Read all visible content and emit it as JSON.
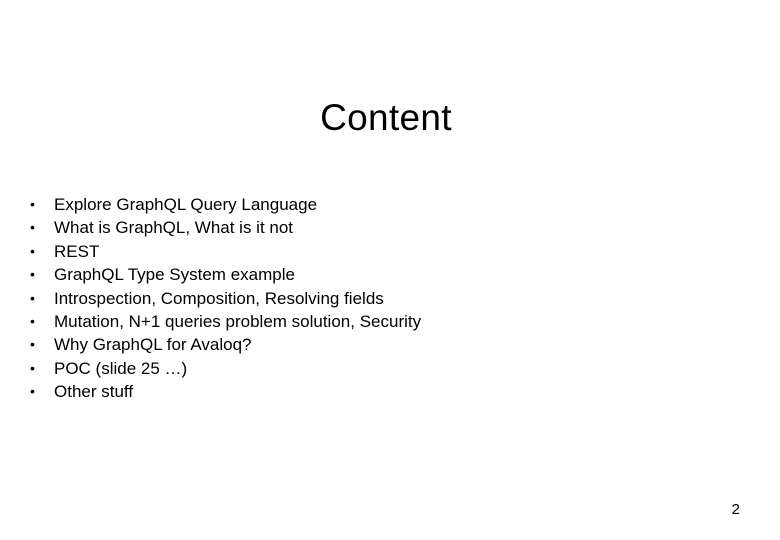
{
  "slide": {
    "title": "Content",
    "bullet_symbol": "•",
    "items": [
      {
        "text": "Explore GraphQL Query Language"
      },
      {
        "text": "What is GraphQL, What is it not"
      },
      {
        "text": "REST"
      },
      {
        "text": "GraphQL Type System example"
      },
      {
        "text": "Introspection, Composition, Resolving fields"
      },
      {
        "text": "Mutation, N+1 queries problem solution, Security"
      },
      {
        "text": "Why GraphQL for Avaloq?"
      },
      {
        "text": "POC (slide 25 …)"
      },
      {
        "text": "Other stuff"
      }
    ],
    "page_number": "2"
  }
}
